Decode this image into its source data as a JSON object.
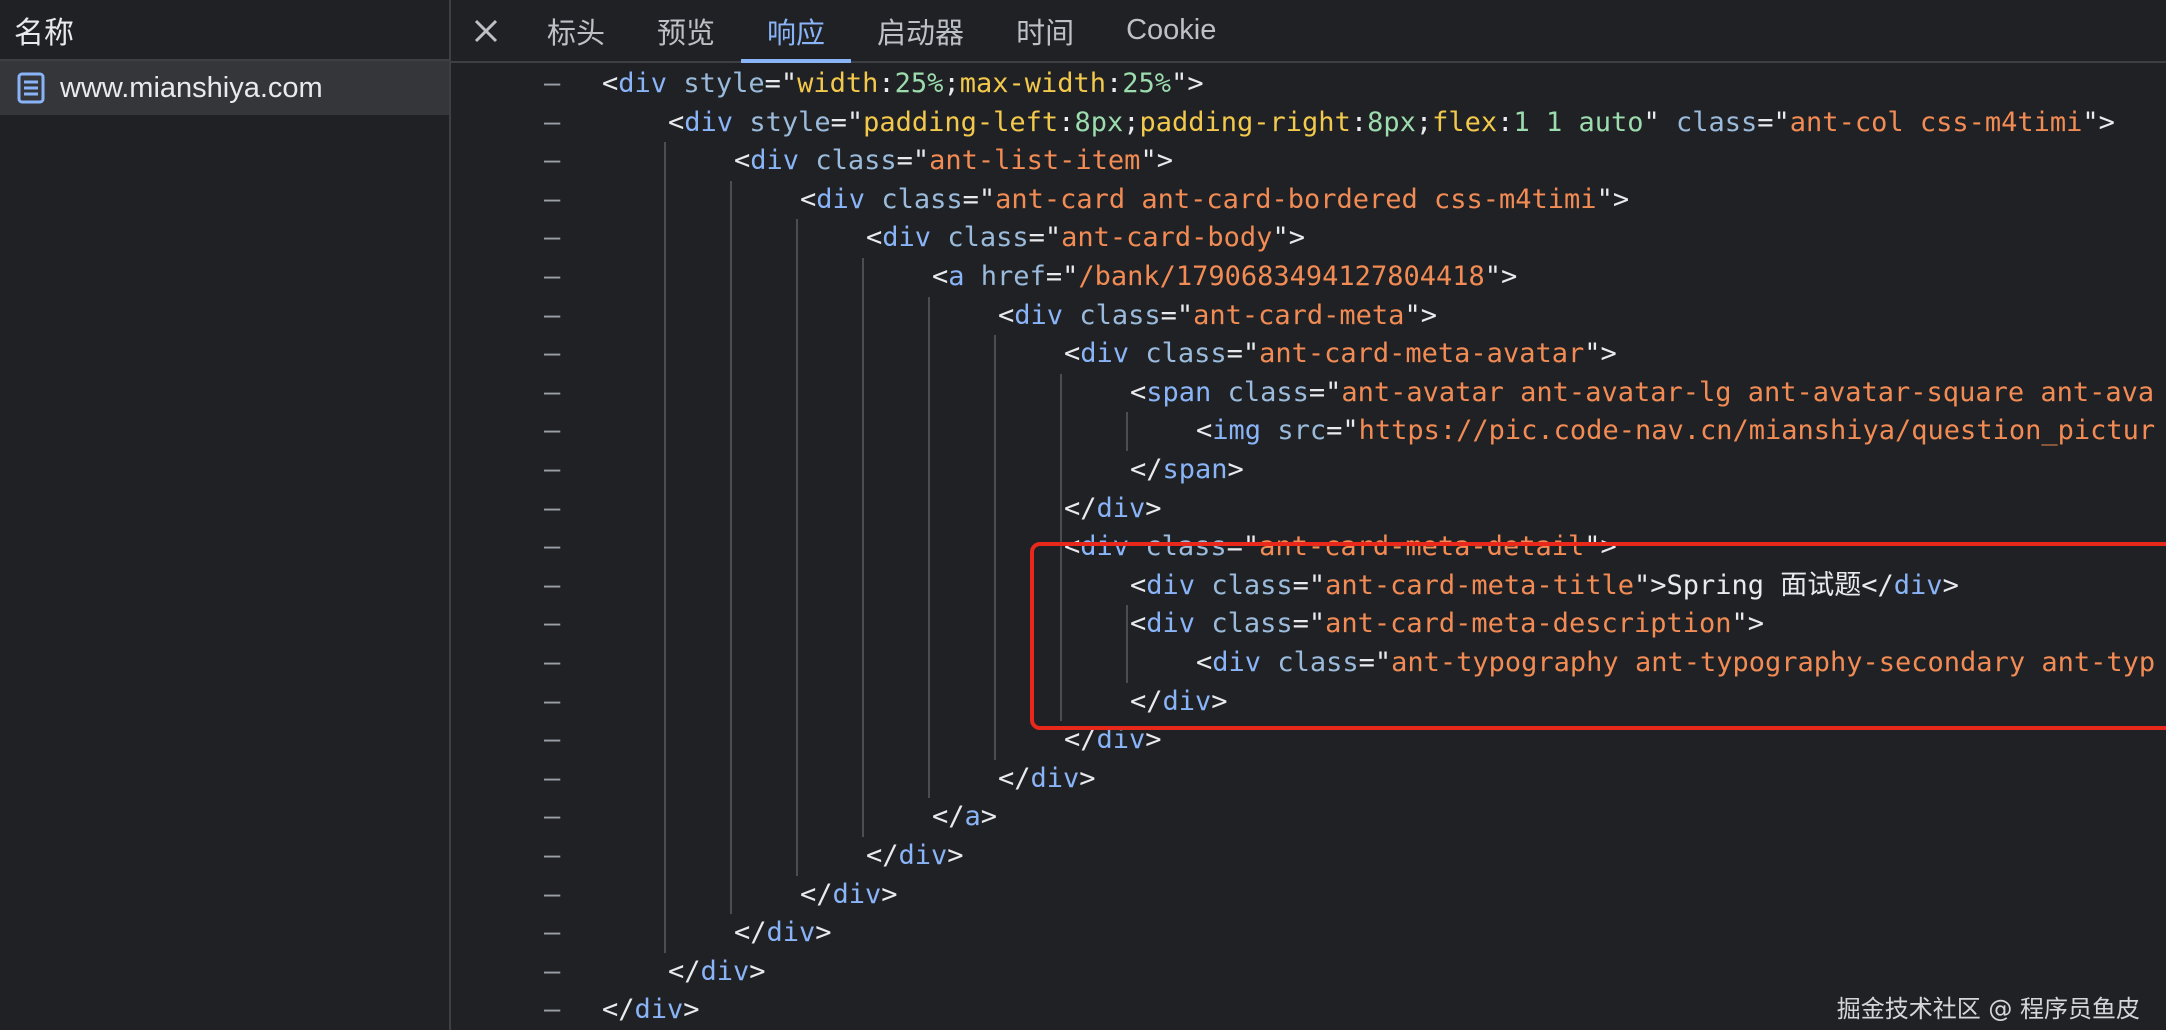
{
  "left_panel": {
    "header": "名称",
    "request": {
      "icon": "document-icon",
      "label": "www.mianshiya.com"
    }
  },
  "tabs": [
    {
      "label": "标头",
      "active": false
    },
    {
      "label": "预览",
      "active": false
    },
    {
      "label": "响应",
      "active": true
    },
    {
      "label": "启动器",
      "active": false
    },
    {
      "label": "时间",
      "active": false
    },
    {
      "label": "Cookie",
      "active": false
    }
  ],
  "close_icon": "close-icon",
  "gutter_symbol": "–",
  "colors": {
    "tag": "#8ab4f8",
    "attr": "#9bbbdc",
    "value": "#f28b54",
    "highlight": "#e8281b",
    "accent": "#8ab4f8"
  },
  "code_lines": [
    {
      "indent": 0,
      "tokens": [
        [
          "p",
          "<"
        ],
        [
          "t",
          "div"
        ],
        [
          "p",
          " "
        ],
        [
          "a",
          "style"
        ],
        [
          "p",
          "=\""
        ],
        [
          "cp",
          "width"
        ],
        [
          "p",
          ":"
        ],
        [
          "cv",
          "25%"
        ],
        [
          "p",
          ";"
        ],
        [
          "cp",
          "max-width"
        ],
        [
          "p",
          ":"
        ],
        [
          "cv",
          "25%"
        ],
        [
          "p",
          "\">"
        ]
      ]
    },
    {
      "indent": 1,
      "tokens": [
        [
          "p",
          "<"
        ],
        [
          "t",
          "div"
        ],
        [
          "p",
          " "
        ],
        [
          "a",
          "style"
        ],
        [
          "p",
          "=\""
        ],
        [
          "cp",
          "padding-left"
        ],
        [
          "p",
          ":"
        ],
        [
          "cv",
          "8px"
        ],
        [
          "p",
          ";"
        ],
        [
          "cp",
          "padding-right"
        ],
        [
          "p",
          ":"
        ],
        [
          "cv",
          "8px"
        ],
        [
          "p",
          ";"
        ],
        [
          "cp",
          "flex"
        ],
        [
          "p",
          ":"
        ],
        [
          "cv",
          "1 1 auto"
        ],
        [
          "p",
          "\" "
        ],
        [
          "a",
          "class"
        ],
        [
          "p",
          "=\""
        ],
        [
          "v",
          "ant-col css-m4timi"
        ],
        [
          "p",
          "\">"
        ]
      ]
    },
    {
      "indent": 2,
      "tokens": [
        [
          "p",
          "<"
        ],
        [
          "t",
          "div"
        ],
        [
          "p",
          " "
        ],
        [
          "a",
          "class"
        ],
        [
          "p",
          "=\""
        ],
        [
          "v",
          "ant-list-item"
        ],
        [
          "p",
          "\">"
        ]
      ]
    },
    {
      "indent": 3,
      "tokens": [
        [
          "p",
          "<"
        ],
        [
          "t",
          "div"
        ],
        [
          "p",
          " "
        ],
        [
          "a",
          "class"
        ],
        [
          "p",
          "=\""
        ],
        [
          "v",
          "ant-card ant-card-bordered css-m4timi"
        ],
        [
          "p",
          "\">"
        ]
      ]
    },
    {
      "indent": 4,
      "tokens": [
        [
          "p",
          "<"
        ],
        [
          "t",
          "div"
        ],
        [
          "p",
          " "
        ],
        [
          "a",
          "class"
        ],
        [
          "p",
          "=\""
        ],
        [
          "v",
          "ant-card-body"
        ],
        [
          "p",
          "\">"
        ]
      ]
    },
    {
      "indent": 5,
      "tokens": [
        [
          "p",
          "<"
        ],
        [
          "t",
          "a"
        ],
        [
          "p",
          " "
        ],
        [
          "a",
          "href"
        ],
        [
          "p",
          "=\""
        ],
        [
          "v",
          "/bank/1790683494127804418"
        ],
        [
          "p",
          "\">"
        ]
      ]
    },
    {
      "indent": 6,
      "tokens": [
        [
          "p",
          "<"
        ],
        [
          "t",
          "div"
        ],
        [
          "p",
          " "
        ],
        [
          "a",
          "class"
        ],
        [
          "p",
          "=\""
        ],
        [
          "v",
          "ant-card-meta"
        ],
        [
          "p",
          "\">"
        ]
      ]
    },
    {
      "indent": 7,
      "tokens": [
        [
          "p",
          "<"
        ],
        [
          "t",
          "div"
        ],
        [
          "p",
          " "
        ],
        [
          "a",
          "class"
        ],
        [
          "p",
          "=\""
        ],
        [
          "v",
          "ant-card-meta-avatar"
        ],
        [
          "p",
          "\">"
        ]
      ]
    },
    {
      "indent": 8,
      "tokens": [
        [
          "p",
          "<"
        ],
        [
          "t",
          "span"
        ],
        [
          "p",
          " "
        ],
        [
          "a",
          "class"
        ],
        [
          "p",
          "=\""
        ],
        [
          "v",
          "ant-avatar ant-avatar-lg ant-avatar-square ant-ava"
        ]
      ]
    },
    {
      "indent": 9,
      "tokens": [
        [
          "p",
          "<"
        ],
        [
          "t",
          "img"
        ],
        [
          "p",
          " "
        ],
        [
          "a",
          "src"
        ],
        [
          "p",
          "=\""
        ],
        [
          "v",
          "https://pic.code-nav.cn/mianshiya/question_pictur"
        ]
      ]
    },
    {
      "indent": 8,
      "tokens": [
        [
          "p",
          "</"
        ],
        [
          "t",
          "span"
        ],
        [
          "p",
          ">"
        ]
      ]
    },
    {
      "indent": 7,
      "tokens": [
        [
          "p",
          "</"
        ],
        [
          "t",
          "div"
        ],
        [
          "p",
          ">"
        ]
      ]
    },
    {
      "indent": 7,
      "tokens": [
        [
          "p",
          "<"
        ],
        [
          "t",
          "div"
        ],
        [
          "p",
          " "
        ],
        [
          "a",
          "class"
        ],
        [
          "p",
          "=\""
        ],
        [
          "v",
          "ant-card-meta-detail"
        ],
        [
          "p",
          "\">"
        ]
      ]
    },
    {
      "indent": 8,
      "tokens": [
        [
          "p",
          "<"
        ],
        [
          "t",
          "div"
        ],
        [
          "p",
          " "
        ],
        [
          "a",
          "class"
        ],
        [
          "p",
          "=\""
        ],
        [
          "v",
          "ant-card-meta-title"
        ],
        [
          "p",
          "\">Spring 面试题</"
        ],
        [
          "t",
          "div"
        ],
        [
          "p",
          ">"
        ]
      ]
    },
    {
      "indent": 8,
      "tokens": [
        [
          "p",
          "<"
        ],
        [
          "t",
          "div"
        ],
        [
          "p",
          " "
        ],
        [
          "a",
          "class"
        ],
        [
          "p",
          "=\""
        ],
        [
          "v",
          "ant-card-meta-description"
        ],
        [
          "p",
          "\">"
        ]
      ]
    },
    {
      "indent": 9,
      "tokens": [
        [
          "p",
          "<"
        ],
        [
          "t",
          "div"
        ],
        [
          "p",
          " "
        ],
        [
          "a",
          "class"
        ],
        [
          "p",
          "=\""
        ],
        [
          "v",
          "ant-typography ant-typography-secondary ant-typ"
        ]
      ]
    },
    {
      "indent": 8,
      "tokens": [
        [
          "p",
          "</"
        ],
        [
          "t",
          "div"
        ],
        [
          "p",
          ">"
        ]
      ]
    },
    {
      "indent": 7,
      "tokens": [
        [
          "p",
          "</"
        ],
        [
          "t",
          "div"
        ],
        [
          "p",
          ">"
        ]
      ]
    },
    {
      "indent": 6,
      "tokens": [
        [
          "p",
          "</"
        ],
        [
          "t",
          "div"
        ],
        [
          "p",
          ">"
        ]
      ]
    },
    {
      "indent": 5,
      "tokens": [
        [
          "p",
          "</"
        ],
        [
          "t",
          "a"
        ],
        [
          "p",
          ">"
        ]
      ]
    },
    {
      "indent": 4,
      "tokens": [
        [
          "p",
          "</"
        ],
        [
          "t",
          "div"
        ],
        [
          "p",
          ">"
        ]
      ]
    },
    {
      "indent": 3,
      "tokens": [
        [
          "p",
          "</"
        ],
        [
          "t",
          "div"
        ],
        [
          "p",
          ">"
        ]
      ]
    },
    {
      "indent": 2,
      "tokens": [
        [
          "p",
          "</"
        ],
        [
          "t",
          "div"
        ],
        [
          "p",
          ">"
        ]
      ]
    },
    {
      "indent": 1,
      "tokens": [
        [
          "p",
          "</"
        ],
        [
          "t",
          "div"
        ],
        [
          "p",
          ">"
        ]
      ]
    },
    {
      "indent": 0,
      "tokens": [
        [
          "p",
          "</"
        ],
        [
          "t",
          "div"
        ],
        [
          "p",
          ">"
        ]
      ]
    }
  ],
  "watermark": "掘金技术社区 @ 程序员鱼皮"
}
